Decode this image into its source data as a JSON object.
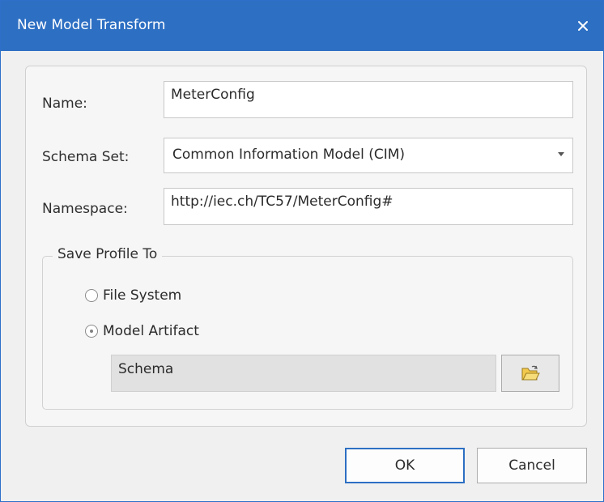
{
  "window": {
    "title": "New Model Transform",
    "title_bar_color": "#2d6fc3"
  },
  "form": {
    "name_label": "Name:",
    "name_value": "MeterConfig",
    "schema_set_label": "Schema Set:",
    "schema_set_value": "Common Information Model (CIM)",
    "namespace_label": "Namespace:",
    "namespace_value": "http://iec.ch/TC57/MeterConfig#"
  },
  "save_profile": {
    "group_label": "Save Profile To",
    "options": [
      {
        "label": "File System",
        "selected": false
      },
      {
        "label": "Model Artifact",
        "selected": true
      }
    ],
    "artifact_value": "Schema",
    "browse_icon": "folder-open-icon"
  },
  "buttons": {
    "ok_label": "OK",
    "cancel_label": "Cancel"
  }
}
